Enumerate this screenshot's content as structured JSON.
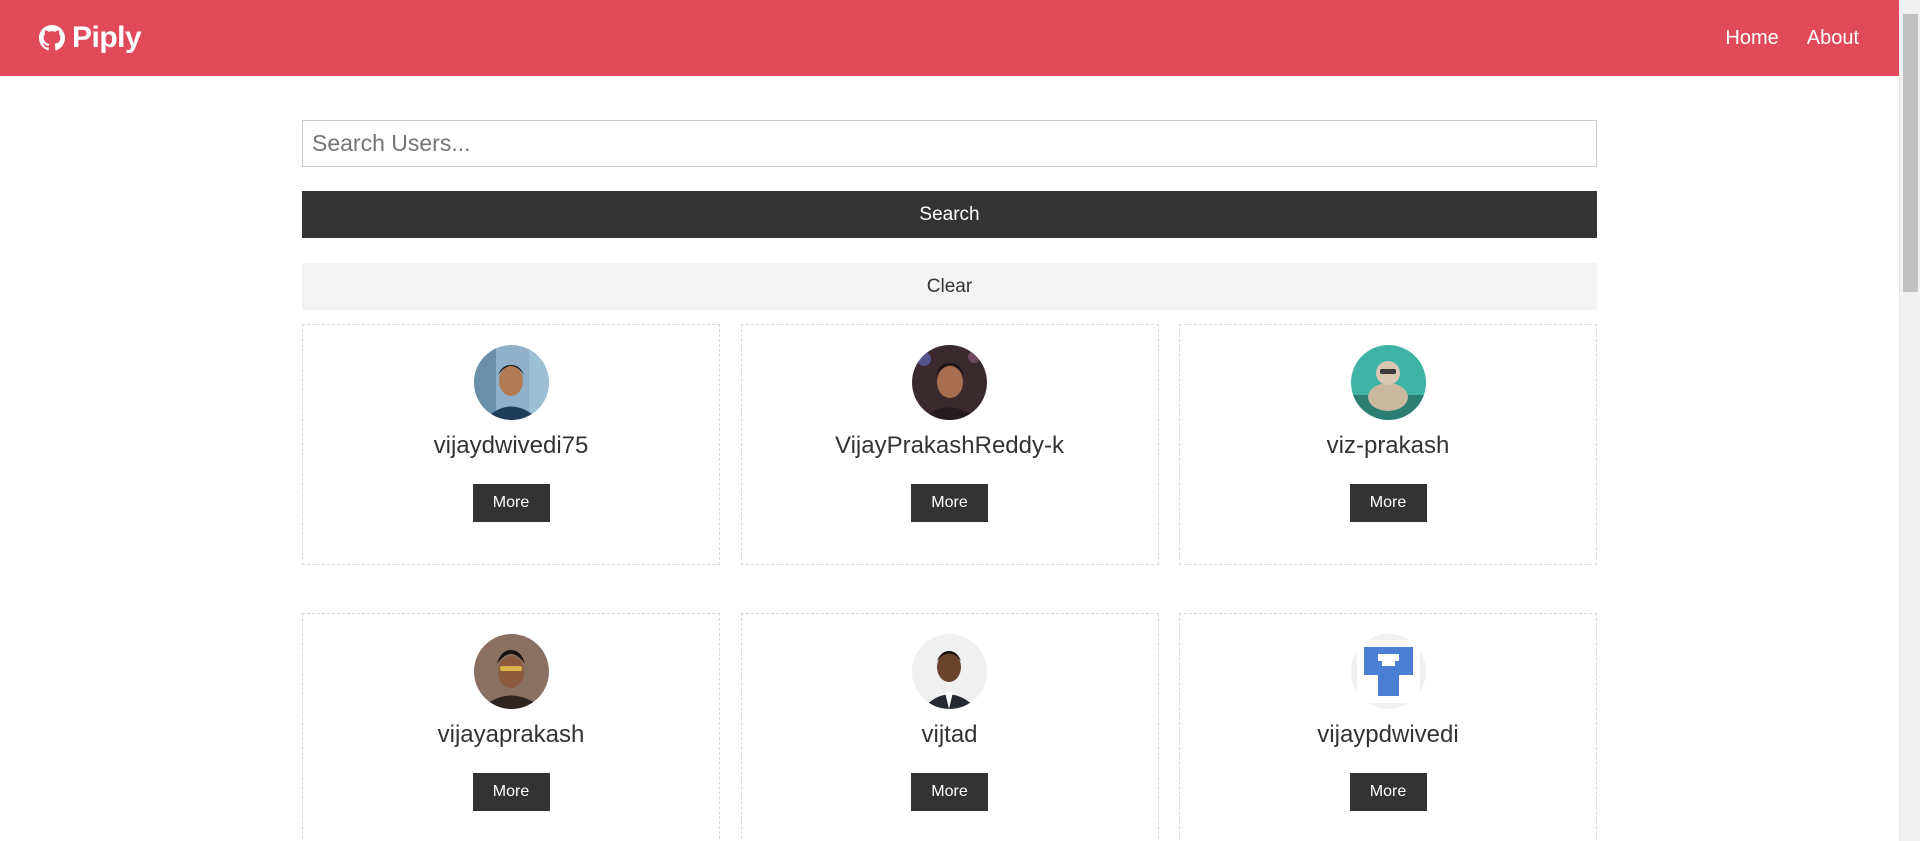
{
  "navbar": {
    "brand": "Piply",
    "links": [
      "Home",
      "About"
    ]
  },
  "search": {
    "placeholder": "Search Users...",
    "value": "",
    "search_label": "Search",
    "clear_label": "Clear"
  },
  "users": [
    {
      "login": "vijaydwivedi75",
      "button": "More"
    },
    {
      "login": "VijayPrakashReddy-k",
      "button": "More"
    },
    {
      "login": "viz-prakash",
      "button": "More"
    },
    {
      "login": "vijayaprakash",
      "button": "More"
    },
    {
      "login": "vijtad",
      "button": "More"
    },
    {
      "login": "vijaypdwivedi",
      "button": "More"
    }
  ],
  "colors": {
    "navbar": "#e04a5a",
    "dark": "#333333",
    "light": "#f4f4f4"
  }
}
